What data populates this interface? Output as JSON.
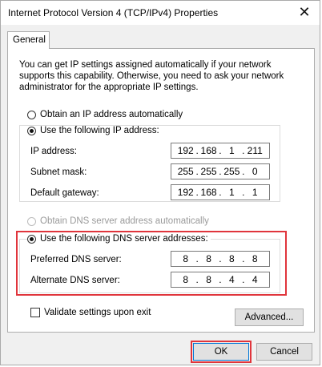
{
  "window": {
    "title": "Internet Protocol Version 4 (TCP/IPv4) Properties",
    "close_glyph": "✕"
  },
  "tabs": [
    {
      "label": "General"
    }
  ],
  "description": "You can get IP settings assigned automatically if your network supports this capability. Otherwise, you need to ask your network administrator for the appropriate IP settings.",
  "ip_mode": {
    "auto_label": "Obtain an IP address automatically",
    "manual_label": "Use the following IP address:",
    "selected": "manual"
  },
  "ip_fields": [
    {
      "label": "IP address:",
      "value": [
        "192",
        "168",
        "1",
        "211"
      ]
    },
    {
      "label": "Subnet mask:",
      "value": [
        "255",
        "255",
        "255",
        "0"
      ]
    },
    {
      "label": "Default gateway:",
      "value": [
        "192",
        "168",
        "1",
        "1"
      ]
    }
  ],
  "dns_mode": {
    "auto_label": "Obtain DNS server address automatically",
    "manual_label": "Use the following DNS server addresses:",
    "selected": "manual"
  },
  "dns_fields": [
    {
      "label": "Preferred DNS server:",
      "value": [
        "8",
        "8",
        "8",
        "8"
      ]
    },
    {
      "label": "Alternate DNS server:",
      "value": [
        "8",
        "8",
        "4",
        "4"
      ]
    }
  ],
  "validate": {
    "label": "Validate settings upon exit",
    "checked": false
  },
  "buttons": {
    "advanced": "Advanced...",
    "ok": "OK",
    "cancel": "Cancel"
  },
  "colors": {
    "highlight": "#e0353c",
    "window_bg": "#f0f0f0"
  }
}
